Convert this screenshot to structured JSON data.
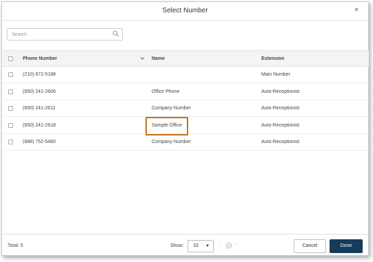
{
  "dialog": {
    "title": "Select Number",
    "close_label": "×"
  },
  "search": {
    "placeholder": "Search",
    "value": ""
  },
  "table": {
    "columns": {
      "phone": "Phone Number",
      "name": "Name",
      "extension": "Extension"
    },
    "rows": [
      {
        "phone": "(210) 672-5188",
        "name": "",
        "extension": "Main Number"
      },
      {
        "phone": "(650) 241-2606",
        "name": "Office Phone",
        "extension": "Auto-Receptionist"
      },
      {
        "phone": "(650) 241-2611",
        "name": "Company Number",
        "extension": "Auto-Receptionist"
      },
      {
        "phone": "(650) 241-2618",
        "name": "Sample Office",
        "extension": "Auto-Receptionist"
      },
      {
        "phone": "(888) 752-5460",
        "name": "Company Number",
        "extension": "Auto-Receptionist"
      }
    ],
    "highlighted_row": 3
  },
  "footer": {
    "total": "Total: 5",
    "show_label": "Show:",
    "page_size": "10",
    "current_page": "1",
    "cancel_label": "Cancel",
    "done_label": "Done"
  },
  "colors": {
    "done_button": "#163c5c",
    "highlight_border": "#c8701f"
  },
  "icons": [
    "close-icon",
    "search-icon",
    "sort-chevron-icon",
    "dropdown-caret-icon",
    "prev-page-icon",
    "next-page-icon"
  ]
}
